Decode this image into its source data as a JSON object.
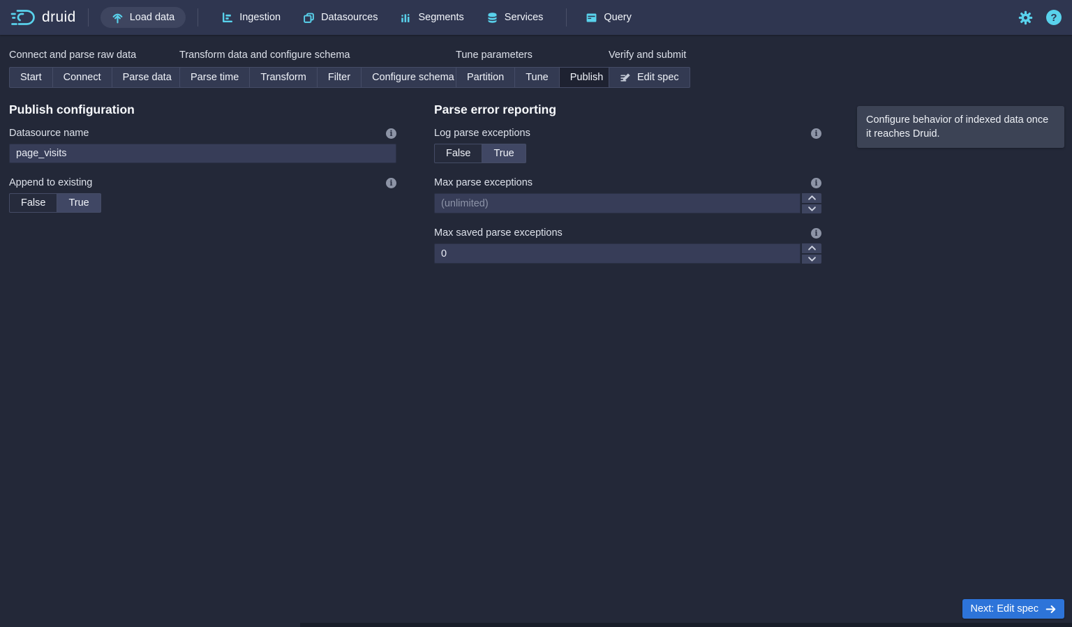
{
  "colors": {
    "accent_cyan": "#59d2ec",
    "primary_blue": "#2d74d9",
    "navbar_bg": "#2f3650",
    "page_bg": "#232838"
  },
  "navbar": {
    "brand": "druid",
    "items": [
      {
        "label": "Load data",
        "icon": "upload-icon",
        "active": true
      },
      {
        "label": "Ingestion",
        "icon": "ingestion-icon"
      },
      {
        "label": "Datasources",
        "icon": "datasources-icon"
      },
      {
        "label": "Segments",
        "icon": "segments-icon"
      },
      {
        "label": "Services",
        "icon": "services-icon"
      },
      {
        "label": "Query",
        "icon": "query-icon"
      }
    ],
    "right_icons": [
      "gear-icon",
      "help-icon"
    ]
  },
  "steps": {
    "groups": [
      {
        "label": "Connect and parse raw data",
        "steps": [
          "Start",
          "Connect",
          "Parse data"
        ]
      },
      {
        "label": "Transform data and configure schema",
        "steps": [
          "Parse time",
          "Transform",
          "Filter",
          "Configure schema"
        ]
      },
      {
        "label": "Tune parameters",
        "steps": [
          "Partition",
          "Tune",
          "Publish"
        ],
        "active_step": "Publish"
      },
      {
        "label": "Verify and submit",
        "steps": [
          "Edit spec"
        ]
      }
    ]
  },
  "publish_config": {
    "title": "Publish configuration",
    "datasource_name": {
      "label": "Datasource name",
      "value": "page_visits"
    },
    "append_to_existing": {
      "label": "Append to existing",
      "options": [
        "False",
        "True"
      ],
      "selected": "True"
    }
  },
  "parse_error": {
    "title": "Parse error reporting",
    "log_parse_exceptions": {
      "label": "Log parse exceptions",
      "options": [
        "False",
        "True"
      ],
      "selected": "True"
    },
    "max_parse_exceptions": {
      "label": "Max parse exceptions",
      "placeholder": "(unlimited)"
    },
    "max_saved_parse_exceptions": {
      "label": "Max saved parse exceptions",
      "value": "0"
    }
  },
  "info_panel": {
    "text": "Configure behavior of indexed data once it reaches Druid."
  },
  "next_button": {
    "label": "Next: Edit spec"
  }
}
